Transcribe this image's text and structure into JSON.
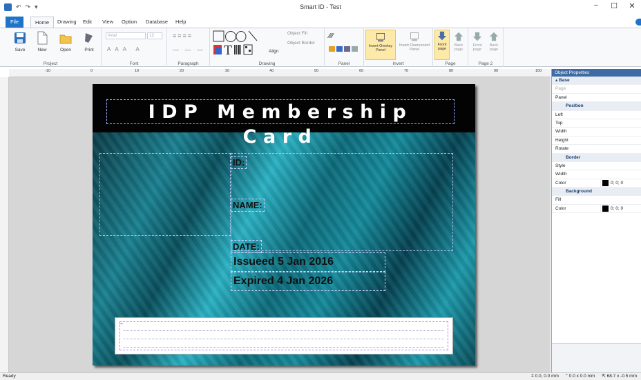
{
  "app": {
    "title": "Smart ID - Test"
  },
  "window_controls": {
    "minimize": "−",
    "maximize": "☐",
    "close": "✕"
  },
  "tabs": [
    "File",
    "Home",
    "Drawing",
    "Edit",
    "View",
    "Option",
    "Database",
    "Help"
  ],
  "ribbon": {
    "project": {
      "label": "Project",
      "save": "Save",
      "new": "New",
      "open": "Open",
      "print": "Print"
    },
    "font": {
      "label": "Font",
      "family": "Arial",
      "size": "12"
    },
    "paragraph": {
      "label": "Paragraph"
    },
    "drawing": {
      "label": "Drawing",
      "align": "Align",
      "object_fill": "Object Fill",
      "object_border": "Object Border"
    },
    "panel": {
      "label": "Panel"
    },
    "invert": {
      "label": "Invert",
      "overlay": "Invert Overlay Panel",
      "fluorescent": "Invert Fluorescent Panel"
    },
    "page": {
      "label": "Page",
      "front": "Front page",
      "back": "Back page"
    },
    "page2": {
      "label": "Page 2",
      "front": "Front page",
      "back": "Back page"
    }
  },
  "ruler": {
    "top": [
      "-10",
      "0",
      "10",
      "20",
      "30",
      "40",
      "50",
      "60",
      "70",
      "80",
      "90",
      "100"
    ]
  },
  "card": {
    "title": "IDP Membership Card",
    "id_label": "ID:",
    "name_label": "NAME:",
    "date_label": "DATE:",
    "issued": "Issueed 5 Jan 2016",
    "expired": "Expired 4 Jan 2026"
  },
  "properties": {
    "header": "Object Properties",
    "base": "Base",
    "page": "Page",
    "panel": "Panel",
    "position": "Position",
    "left": "Left",
    "top": "Top",
    "width": "Width",
    "height": "Height",
    "rotate": "Rotate",
    "border": "Border",
    "style": "Style",
    "border_width": "Width",
    "color": "Color",
    "color_value": "0; 0; 0",
    "background": "Background",
    "fill": "Fill",
    "bg_color": "Color",
    "bg_color_value": "0; 0; 0"
  },
  "status": {
    "left": "Ready",
    "pos": "0.0, 0.0 mm",
    "size": "0.0 x 0.0 mm",
    "cursor": "68.7 x -0.5 mm"
  },
  "colors": {
    "accent": "#1f73c9",
    "card_header": "#030303",
    "card_bg": "#0d4a57"
  }
}
